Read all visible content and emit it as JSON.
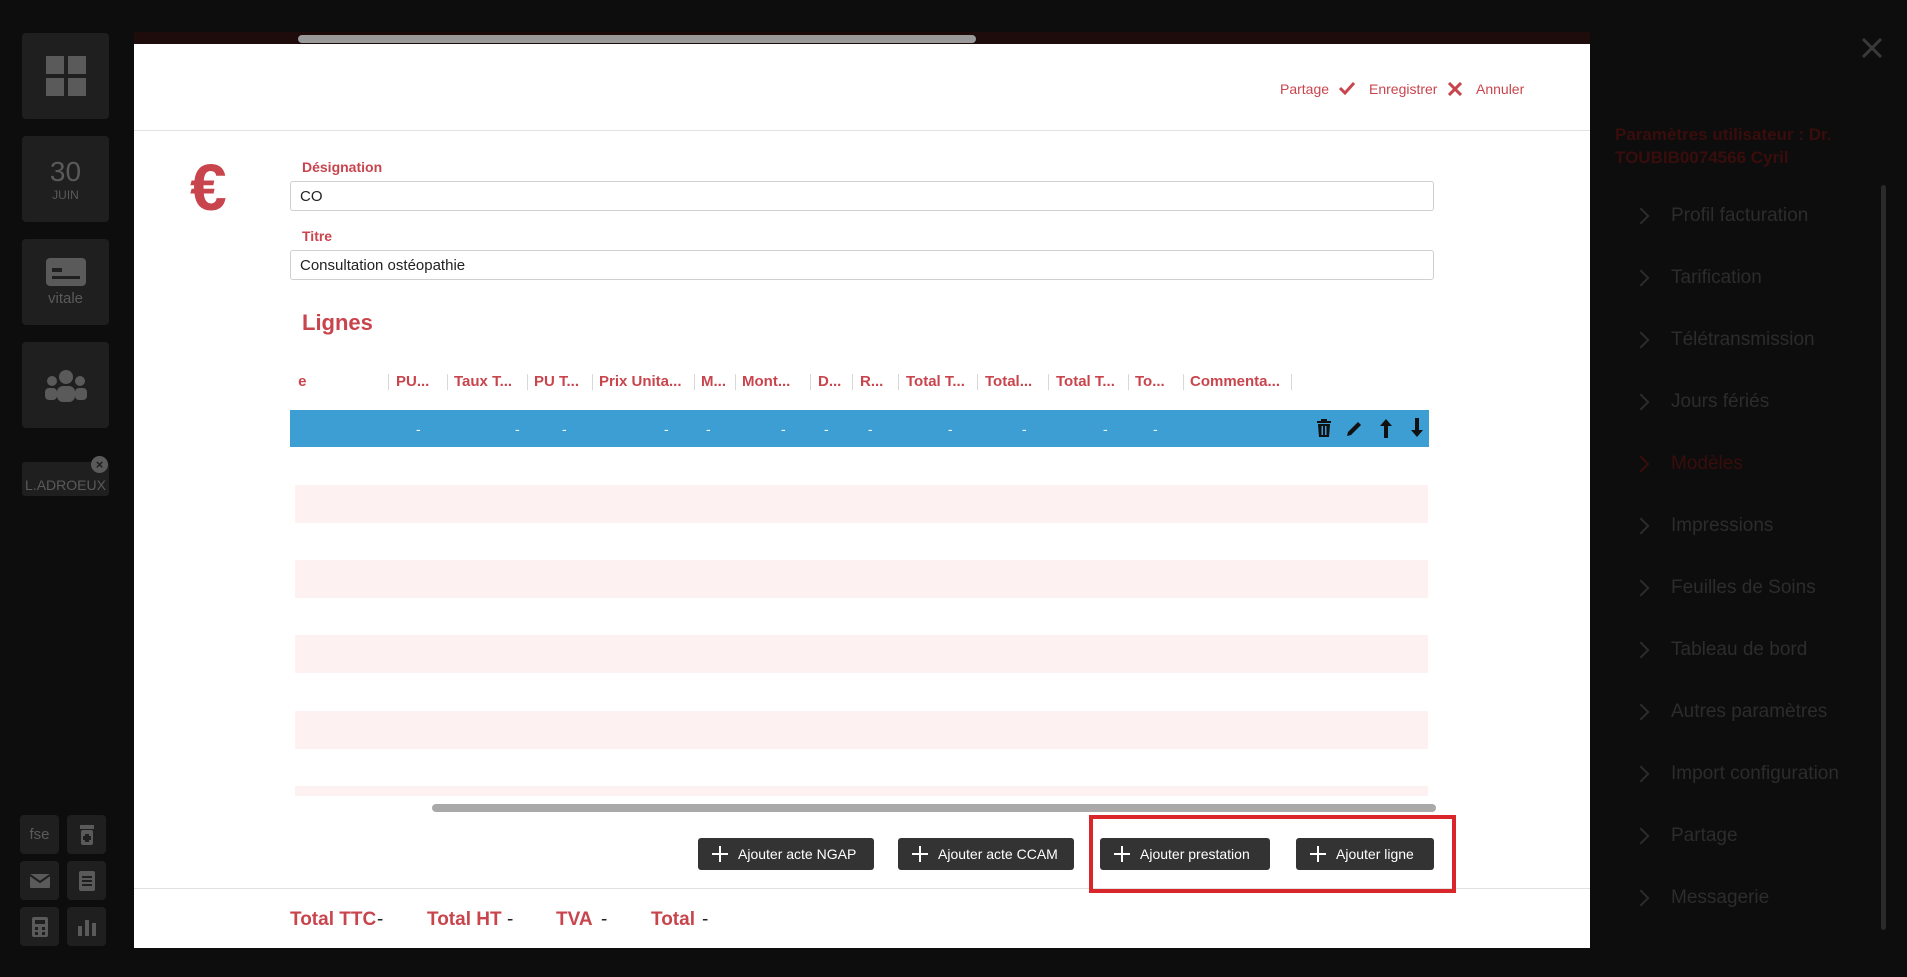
{
  "left_rail": {
    "date_day": "30",
    "date_month": "JUIN",
    "vitale_label": "vitale",
    "patient_tag": "L.ADROEUX",
    "fse_label": "fse"
  },
  "right_panel": {
    "title": "Paramètres utilisateur : Dr. TOUBIB0074566 Cyril",
    "items": [
      "Profil facturation",
      "Tarification",
      "Télétransmission",
      "Jours fériés",
      "Modèles",
      "Impressions",
      "Feuilles de Soins",
      "Tableau de bord",
      "Autres paramètres",
      "Import configuration",
      "Partage",
      "Messagerie"
    ]
  },
  "modal": {
    "header": {
      "share": "Partage",
      "save": "Enregistrer",
      "cancel": "Annuler"
    },
    "currency_symbol": "€",
    "designation": {
      "label": "Désignation",
      "value": "CO"
    },
    "titre": {
      "label": "Titre",
      "value": "Consultation ostéopathie"
    },
    "lignes_title": "Lignes",
    "columns": [
      " e",
      "PU...",
      "Taux T...",
      "PU T...",
      "Prix Unita...",
      "M...",
      "Mont...",
      "D...",
      "R...",
      "Total T...",
      "Total...",
      "Total T...",
      "To...",
      "Commenta..."
    ],
    "row_values": [
      "-",
      "-",
      "-",
      "-",
      "-",
      "-",
      "-",
      "-",
      "-",
      "-",
      "-",
      "-"
    ],
    "buttons": {
      "ngap": "Ajouter acte NGAP",
      "ccam": "Ajouter acte CCAM",
      "prestation": "Ajouter prestation",
      "ligne": "Ajouter ligne"
    },
    "totals": [
      {
        "label": "Total TTC",
        "value": "-"
      },
      {
        "label": "Total HT",
        "value": "-"
      },
      {
        "label": "TVA",
        "value": "-"
      },
      {
        "label": "Total",
        "value": "-"
      }
    ]
  },
  "colors": {
    "accent": "#c9454d",
    "row_selected": "#3d9ed3",
    "highlight_box": "#d9262b"
  }
}
